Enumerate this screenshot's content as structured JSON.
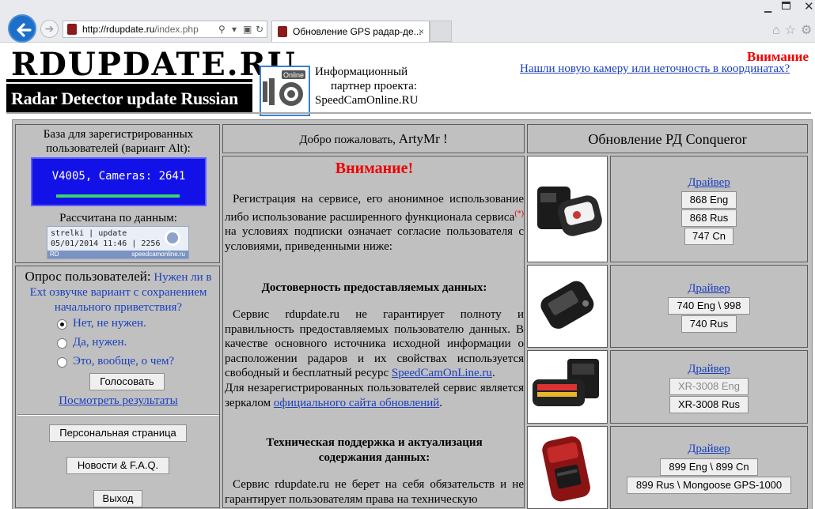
{
  "browser": {
    "url_domain": "http://rdupdate.ru",
    "url_path": "/index.php",
    "tab_title": "Обновление GPS радар-де...",
    "tab_close": "×",
    "back_icon": "back-arrow-icon",
    "forward_icon": "forward-arrow-icon"
  },
  "header": {
    "logo_title": "RDUPDATE.RU",
    "logo_subtitle": "Radar Detector update Russian site",
    "partner_lines": [
      "Информационный",
      "партнер проекта:",
      "SpeedCamOnline.RU"
    ],
    "attention": "Внимание",
    "report_link": "Нашли новую камеру или неточность в координатах?"
  },
  "db": {
    "title": "База для зарегистрированных пользователей (вариант Alt):",
    "display": "V4005, Cameras: 2641",
    "calc_label": "Рассчитана по данным:",
    "img_line1": "strelki | update",
    "img_line2": "05/01/2014 11:46 | 2256",
    "img_strip_left": "RD",
    "img_strip_right": "speedcamonline.ru"
  },
  "poll": {
    "heading": "Опрос пользователей:",
    "question": "Нужен ли в Ext озвучке вариант с сохранением начального приветствия?",
    "options": [
      {
        "label": "Нет, не нужен.",
        "selected": true
      },
      {
        "label": "Да, нужен.",
        "selected": false
      },
      {
        "label": "Это, вообще, о чем?",
        "selected": false
      }
    ],
    "vote_button": "Голосовать",
    "results_link": "Посмотреть результаты"
  },
  "nav": {
    "personal": "Персональная страница",
    "news": "Новости & F.A.Q.",
    "exit": "Выход"
  },
  "welcome": {
    "greeting": "Добро пожаловать,",
    "user": "ArtyMr !"
  },
  "notice": {
    "title": "Внимание!",
    "p1_a": "Регистрация на сервисе, его анонимное использование либо использование расширенного функционала сервиса",
    "p1_mark": "(*)",
    "p1_b": " на условиях подписки означает согласие пользователя с условиями, приведенными ниже:",
    "h1": "Достоверность предоставляемых данных:",
    "p2_a": "Сервис rdupdate.ru не гарантирует полноту и правильность предоставляемых пользователю данных. В качестве основного источника исходной информации о расположении радаров и их свойствах используется свободный и бесплатный ресурс ",
    "p2_link": "SpeedCamOnLine.ru",
    "p2_b": ".",
    "p3_a": "Для незарегистрированных пользователей сервис является зеркалом ",
    "p3_link": "официального сайта обновлений",
    "p3_b": ".",
    "h2": "Техническая поддержка и актуализация содержания данных:",
    "p4": "Сервис rdupdate.ru не берет на себя обязательств и не гарантирует пользователям права на техническую"
  },
  "updates": {
    "title": "Обновление РД Conqueror",
    "products": [
      {
        "driver": "Драйвер",
        "buttons": [
          {
            "label": "868 Eng",
            "enabled": true
          },
          {
            "label": "868 Rus",
            "enabled": true
          },
          {
            "label": "747 Cn",
            "enabled": true
          }
        ]
      },
      {
        "driver": "Драйвер",
        "buttons": [
          {
            "label": "740 Eng \\ 998",
            "enabled": true
          },
          {
            "label": "740 Rus",
            "enabled": true
          }
        ]
      },
      {
        "driver": "Драйвер",
        "buttons": [
          {
            "label": "XR-3008 Eng",
            "enabled": false
          },
          {
            "label": "XR-3008 Rus",
            "enabled": true
          }
        ]
      },
      {
        "driver": "Драйвер",
        "buttons": [
          {
            "label": "899 Eng \\ 899 Cn",
            "enabled": true
          },
          {
            "label": "899 Rus \\ Mongoose GPS-1000",
            "enabled": true
          }
        ]
      }
    ]
  }
}
